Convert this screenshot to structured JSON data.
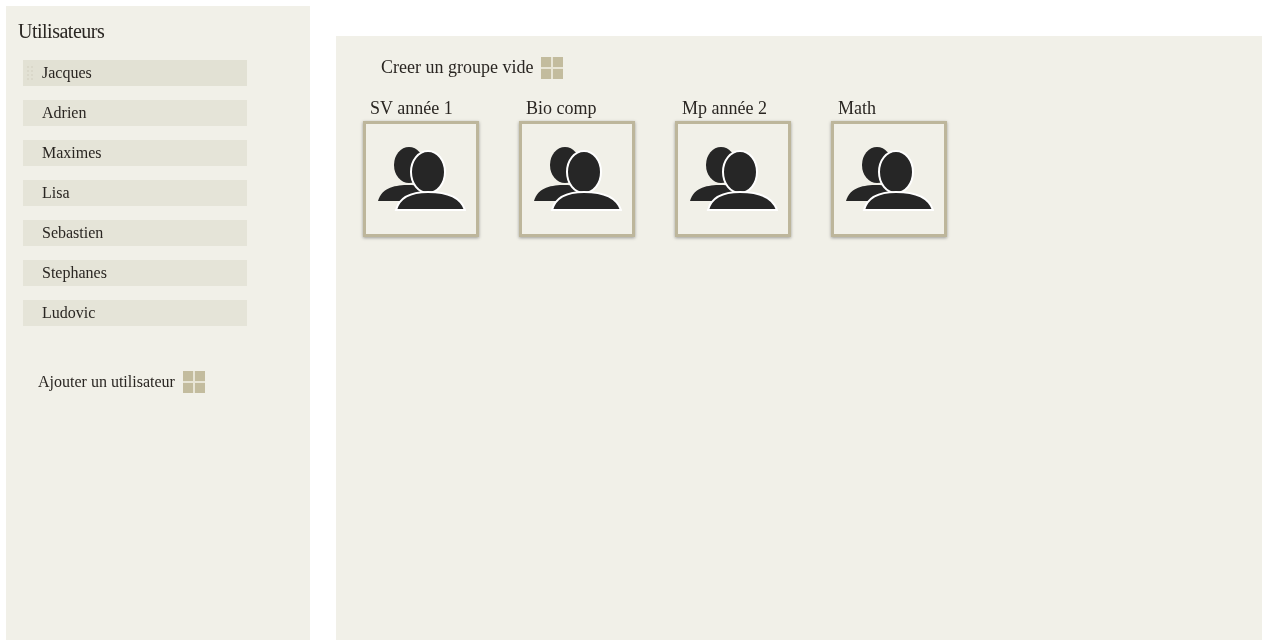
{
  "sidebar": {
    "title": "Utilisateurs",
    "users": [
      {
        "name": "Jacques",
        "hovered": true
      },
      {
        "name": "Adrien",
        "hovered": false
      },
      {
        "name": "Maximes",
        "hovered": false
      },
      {
        "name": "Lisa",
        "hovered": false
      },
      {
        "name": "Sebastien",
        "hovered": false
      },
      {
        "name": "Stephanes",
        "hovered": false
      },
      {
        "name": "Ludovic",
        "hovered": false
      }
    ],
    "add_user": "Ajouter un utilisateur"
  },
  "main": {
    "create_group": "Creer un groupe vide",
    "groups": [
      {
        "name": "SV année 1"
      },
      {
        "name": "Bio comp"
      },
      {
        "name": "Mp année 2"
      },
      {
        "name": "Math"
      }
    ]
  }
}
